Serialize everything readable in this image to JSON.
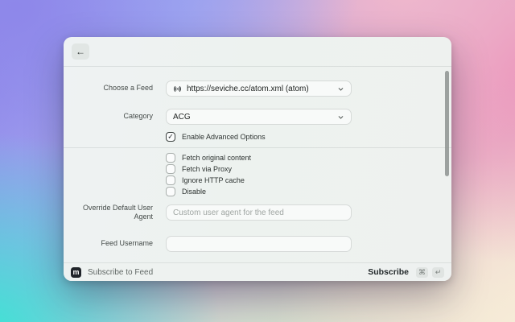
{
  "window": {
    "back_glyph": "←"
  },
  "form": {
    "feed": {
      "label": "Choose a Feed",
      "value": "https://seviche.cc/atom.xml (atom)"
    },
    "category": {
      "label": "Category",
      "value": "ACG"
    },
    "advanced": {
      "label": "Enable Advanced Options",
      "checked": true,
      "check_glyph": "✓"
    },
    "options": [
      {
        "label": "Fetch original content",
        "checked": false
      },
      {
        "label": "Fetch via Proxy",
        "checked": false
      },
      {
        "label": "Ignore HTTP cache",
        "checked": false
      },
      {
        "label": "Disable",
        "checked": false
      }
    ],
    "user_agent": {
      "label": "Override Default User Agent",
      "placeholder": "Custom user agent for the feed",
      "value": ""
    },
    "feed_username": {
      "label": "Feed Username",
      "value": ""
    }
  },
  "footer": {
    "logo_letter": "m",
    "app_name": "Subscribe to Feed",
    "action": "Subscribe",
    "shortcut_keys": [
      "⌘",
      "↵"
    ]
  },
  "colors": {
    "dialog_bg": "#edf2ef",
    "accent_text": "#1e2220",
    "label_text": "#454b49",
    "placeholder": "#a0a6a3",
    "bg_purple": "#8e87ea",
    "bg_pink": "#ea8fb9",
    "bg_teal": "#3ee4d4",
    "bg_cream": "#f7ecd8"
  }
}
